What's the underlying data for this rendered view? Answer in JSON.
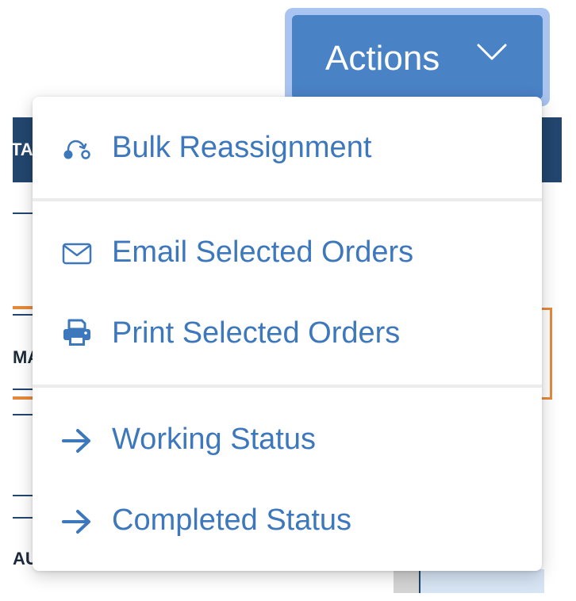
{
  "actions_button": {
    "label": "Actions",
    "icon": "chevron-down-icon"
  },
  "menu": {
    "items": [
      {
        "label": "Bulk Reassignment",
        "icon": "reassign-icon"
      },
      {
        "label": "Email Selected Orders",
        "icon": "envelope-icon"
      },
      {
        "label": "Print Selected Orders",
        "icon": "printer-icon"
      },
      {
        "label": "Working Status",
        "icon": "arrow-right-icon"
      },
      {
        "label": "Completed Status",
        "icon": "arrow-right-icon"
      }
    ]
  },
  "background": {
    "header_fragment": "TAI",
    "row_fragments": [
      "MA",
      "AU"
    ]
  },
  "colors": {
    "accent": "#4a82c6",
    "menu_text": "#3d77bc",
    "header_bg": "#22466e",
    "highlight": "#e58a3c"
  }
}
